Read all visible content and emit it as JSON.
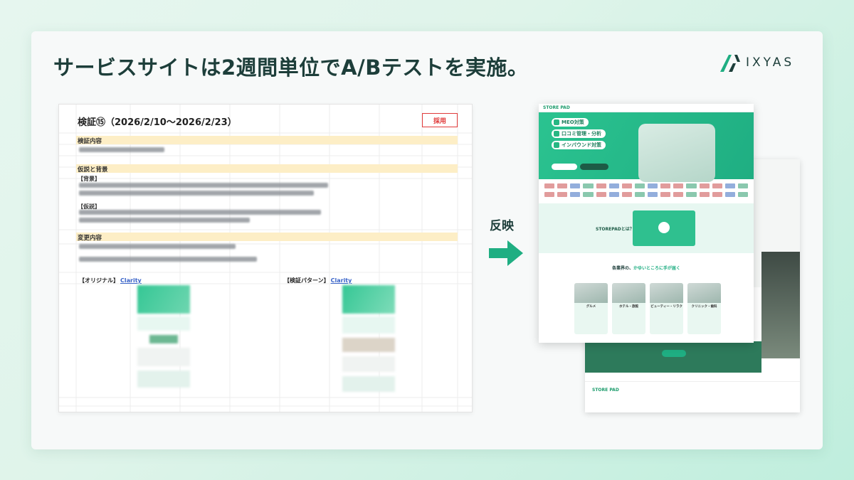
{
  "headline": "サービスサイトは2週間単位でA/Bテストを実施。",
  "logo": {
    "text": "IXYAS",
    "color": "#1d3e3a",
    "accent": "#1fae82"
  },
  "sheet": {
    "title": "検証⑮（2026/2/10〜2026/2/23）",
    "badge": "採用",
    "sections": {
      "content": "検証内容",
      "hypothesis": "仮説と背景",
      "background": "【背景】",
      "hypo": "【仮説】",
      "changes": "変更内容"
    },
    "columns": {
      "original": "【オリジナル】",
      "variant": "【検証パターン】",
      "link": "Clarity"
    }
  },
  "reflect_label": "反映",
  "site": {
    "brand": "STORE PAD",
    "tags": [
      "MEO対策",
      "口コミ管理・分析",
      "インバウンド対策"
    ],
    "video_title": "STOREPADとは？",
    "section_title_a": "各業界の、",
    "section_title_b": "かゆいところに手が届く",
    "cards": [
      "グルメ",
      "ホテル・旅館",
      "ビューティー・リラク",
      "クリニック・歯科"
    ]
  }
}
